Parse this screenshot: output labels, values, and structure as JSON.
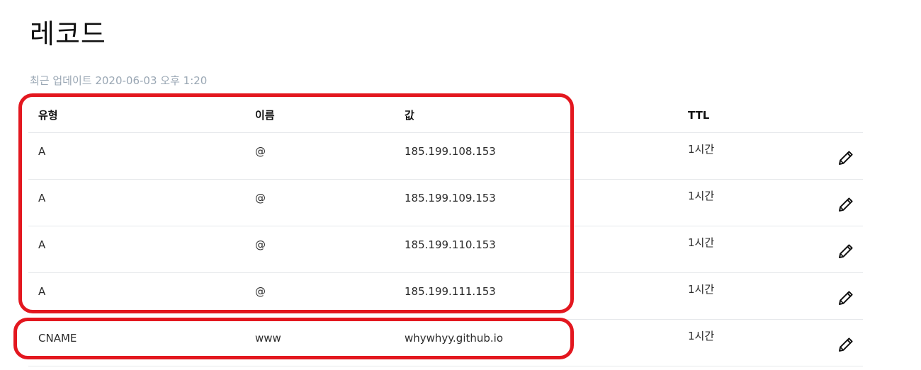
{
  "page": {
    "title": "레코드",
    "last_updated": "최근 업데이트 2020-06-03 오후 1:20"
  },
  "table": {
    "headers": {
      "type": "유형",
      "name": "이름",
      "value": "값",
      "ttl": "TTL"
    },
    "rows": [
      {
        "type": "A",
        "name": "@",
        "value": "185.199.108.153",
        "ttl": "1시간"
      },
      {
        "type": "A",
        "name": "@",
        "value": "185.199.109.153",
        "ttl": "1시간"
      },
      {
        "type": "A",
        "name": "@",
        "value": "185.199.110.153",
        "ttl": "1시간"
      },
      {
        "type": "A",
        "name": "@",
        "value": "185.199.111.153",
        "ttl": "1시간"
      },
      {
        "type": "CNAME",
        "name": "www",
        "value": "whywhyy.github.io",
        "ttl": "1시간"
      }
    ]
  },
  "icons": {
    "edit": "pencil-icon"
  },
  "colors": {
    "highlight": "#e3171f",
    "muted_text": "#9aa7b4",
    "divider": "#e6e8eb"
  }
}
